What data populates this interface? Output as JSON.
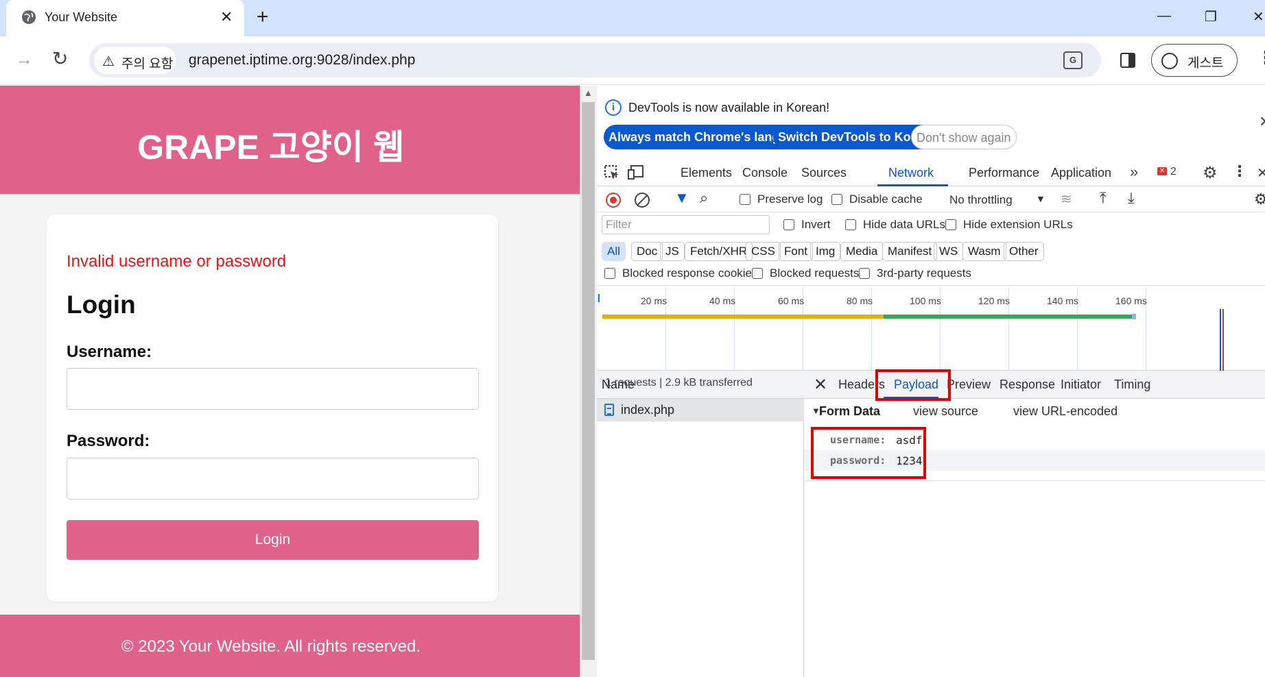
{
  "browser": {
    "tab_title": "Your Website",
    "security_chip": "주의 요함",
    "url": "grapenet.iptime.org:9028/index.php",
    "profile_label": "게스트"
  },
  "site": {
    "title": "GRAPE 고양이 웹",
    "error": "Invalid username or password",
    "login_heading": "Login",
    "username_label": "Username:",
    "username_value": "",
    "password_label": "Password:",
    "password_value": "",
    "login_button": "Login",
    "footer": "© 2023 Your Website. All rights reserved."
  },
  "devtools": {
    "banner": {
      "message": "DevTools is now available in Korean!",
      "btn_match": "Always match Chrome's language",
      "btn_switch": "Switch DevTools to Korean",
      "btn_dismiss": "Don't show again"
    },
    "tabs": [
      "Elements",
      "Console",
      "Sources",
      "Network",
      "Performance",
      "Application"
    ],
    "active_tab": "Network",
    "error_count": "2",
    "toolbar": {
      "preserve_log": "Preserve log",
      "disable_cache": "Disable cache",
      "throttling": "No throttling"
    },
    "filter": {
      "placeholder": "Filter",
      "invert": "Invert",
      "hide_data_urls": "Hide data URLs",
      "hide_extension_urls": "Hide extension URLs"
    },
    "type_filters": [
      "All",
      "Doc",
      "JS",
      "Fetch/XHR",
      "CSS",
      "Font",
      "Img",
      "Media",
      "Manifest",
      "WS",
      "Wasm",
      "Other"
    ],
    "active_type": "All",
    "blocked": {
      "response_cookies": "Blocked response cookies",
      "requests": "Blocked requests",
      "third_party": "3rd-party requests"
    },
    "timeline_ticks": [
      "20 ms",
      "40 ms",
      "60 ms",
      "80 ms",
      "100 ms",
      "120 ms",
      "140 ms",
      "160 ms"
    ],
    "name_header": "Name",
    "requests": [
      {
        "name": "index.php"
      }
    ],
    "status_text": "1 requests  |  2.9 kB transferred",
    "detail_tabs": [
      "Headers",
      "Payload",
      "Preview",
      "Response",
      "Initiator",
      "Timing"
    ],
    "active_detail_tab": "Payload",
    "form_data": {
      "title": "Form Data",
      "view_source": "view source",
      "view_url_encoded": "view URL-encoded",
      "fields": [
        {
          "key": "username:",
          "value": "asdf"
        },
        {
          "key": "password:",
          "value": "1234"
        }
      ]
    }
  },
  "colors": {
    "brand_pink": "#e0628b",
    "error_red": "#ee1111",
    "devtools_blue": "#0b57d0",
    "annotation_red": "#e00000"
  }
}
